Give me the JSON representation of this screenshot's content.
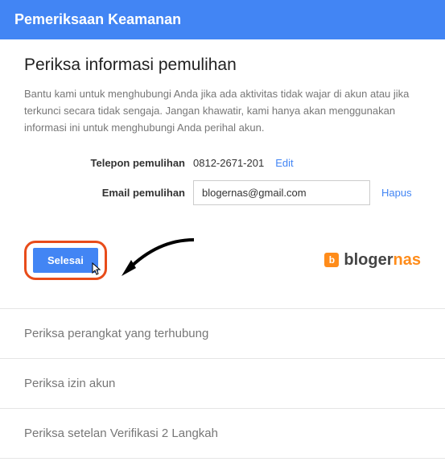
{
  "header": {
    "title": "Pemeriksaan Keamanan"
  },
  "main": {
    "section_title": "Periksa informasi pemulihan",
    "description": "Bantu kami untuk menghubungi Anda jika ada aktivitas tidak wajar di akun atau jika terkunci secara tidak sengaja. Jangan khawatir, kami hanya akan menggunakan informasi ini untuk menghubungi Anda perihal akun.",
    "phone": {
      "label": "Telepon pemulihan",
      "value": "0812-2671-201",
      "edit_link": "Edit"
    },
    "email": {
      "label": "Email pemulihan",
      "value": "blogernas@gmail.com",
      "remove_link": "Hapus"
    },
    "done_button": "Selesai"
  },
  "logo": {
    "icon_letter": "b",
    "text_prefix": "bloger",
    "text_suffix": "nas"
  },
  "list": {
    "items": [
      "Periksa perangkat yang terhubung",
      "Periksa izin akun",
      "Periksa setelan Verifikasi 2 Langkah"
    ]
  }
}
